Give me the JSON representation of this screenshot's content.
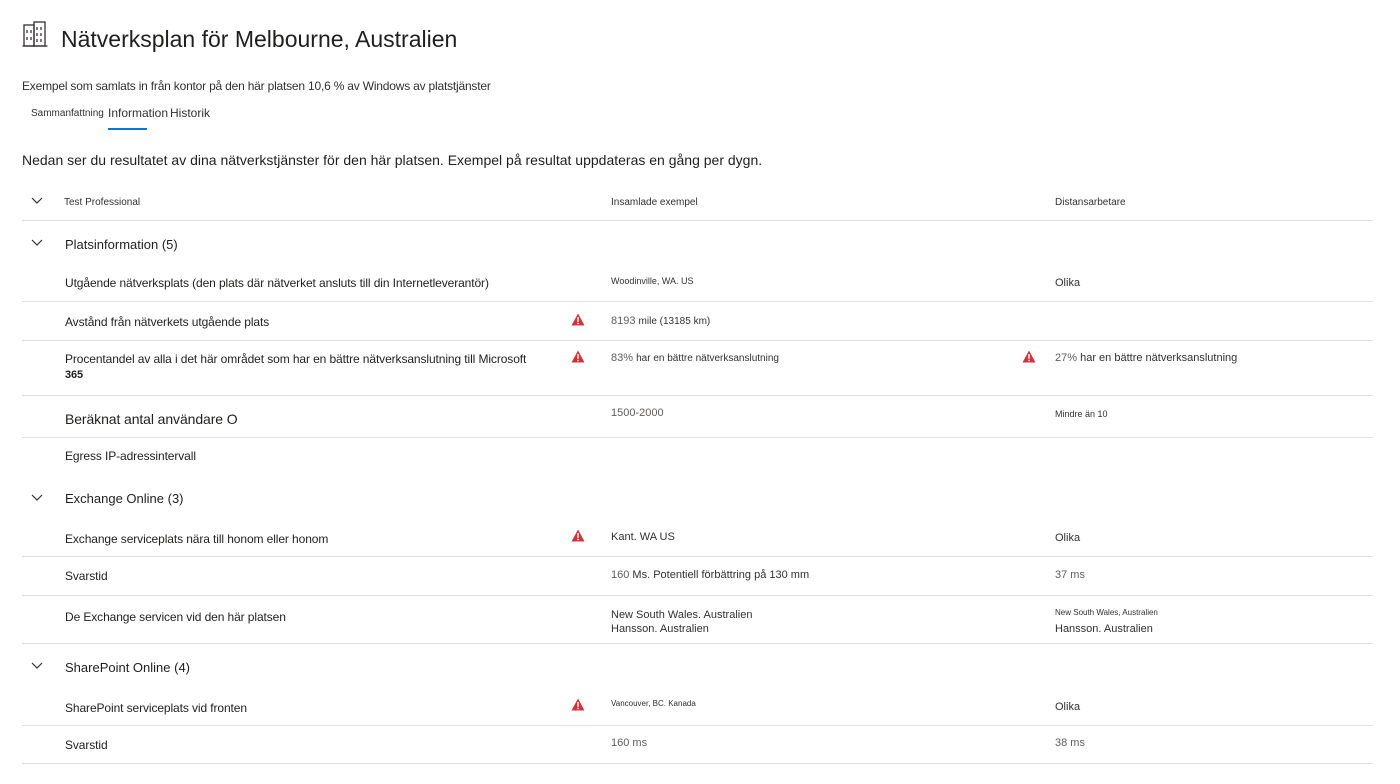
{
  "header": {
    "icon": "office-building-icon",
    "title": "Nätverksplan för Melbourne, Australien",
    "subtitle": "Exempel som samlats in från kontor på den här platsen 10,6 % av Windows av platstjänster"
  },
  "tabs": [
    {
      "label": "Sammanfattning",
      "selected": false
    },
    {
      "label": "Information",
      "selected": true
    },
    {
      "label": "Historik",
      "selected": false
    }
  ],
  "intro": "Nedan ser du resultatet av dina nätverkstjänster för den här platsen. Exempel på resultat uppdateras en gång per dygn.",
  "table": {
    "columns": [
      "Test Professional",
      "Insamlade exempel",
      "Distansarbetare"
    ],
    "groups": [
      {
        "title": "Platsinformation (5)",
        "rows": [
          {
            "label": "Utgående nätverksplats (den plats där nätverket ansluts till din Internetleverantör)",
            "collected": "Woodinville, WA. US",
            "remote": "Olika"
          },
          {
            "label": "Avstånd från nätverkets utgående plats",
            "collected_num": "8193",
            "collected": "mile (13185 km)",
            "remote": ""
          },
          {
            "label": "Procentandel av alla i det här området som har en bättre nätverksanslutning till Microsoft",
            "label_line2": "365",
            "collected_num": "83%",
            "collected": "har en bättre nätverksanslutning",
            "remote_num": "27%",
            "remote": "har en bättre nätverksanslutning"
          },
          {
            "label": "Beräknat antal användare O",
            "collected": "1500-2000",
            "remote": "Mindre än 10"
          },
          {
            "label": "Egress IP-adressintervall",
            "collected": "",
            "remote": ""
          }
        ]
      },
      {
        "title": "Exchange Online (3)",
        "rows": [
          {
            "label": "Exchange serviceplats nära till honom eller honom",
            "collected": "Kant. WA US",
            "remote": "Olika"
          },
          {
            "label": "Svarstid",
            "collected_num": "160",
            "collected": "Ms. Potentiell förbättring på 130 mm",
            "remote": "37 ms"
          },
          {
            "label": "De Exchange servicen vid den här platsen",
            "collected": "New South Wales. Australien",
            "collected_line2": "Hansson. Australien",
            "remote": "New South Wales, Australien",
            "remote_line2": "Hansson. Australien"
          }
        ]
      },
      {
        "title": "SharePoint Online (4)",
        "rows": [
          {
            "label": "SharePoint serviceplats vid fronten",
            "collected": "Vancouver, BC. Kanada",
            "remote": "Olika"
          },
          {
            "label": "Svarstid",
            "collected": "160 ms",
            "remote": "38 ms"
          }
        ]
      }
    ]
  },
  "icons": {
    "warning": "warning-triangle-icon",
    "chevron": "chevron-down-icon",
    "warning_color": "#d13438",
    "accent": "#0078d4"
  }
}
